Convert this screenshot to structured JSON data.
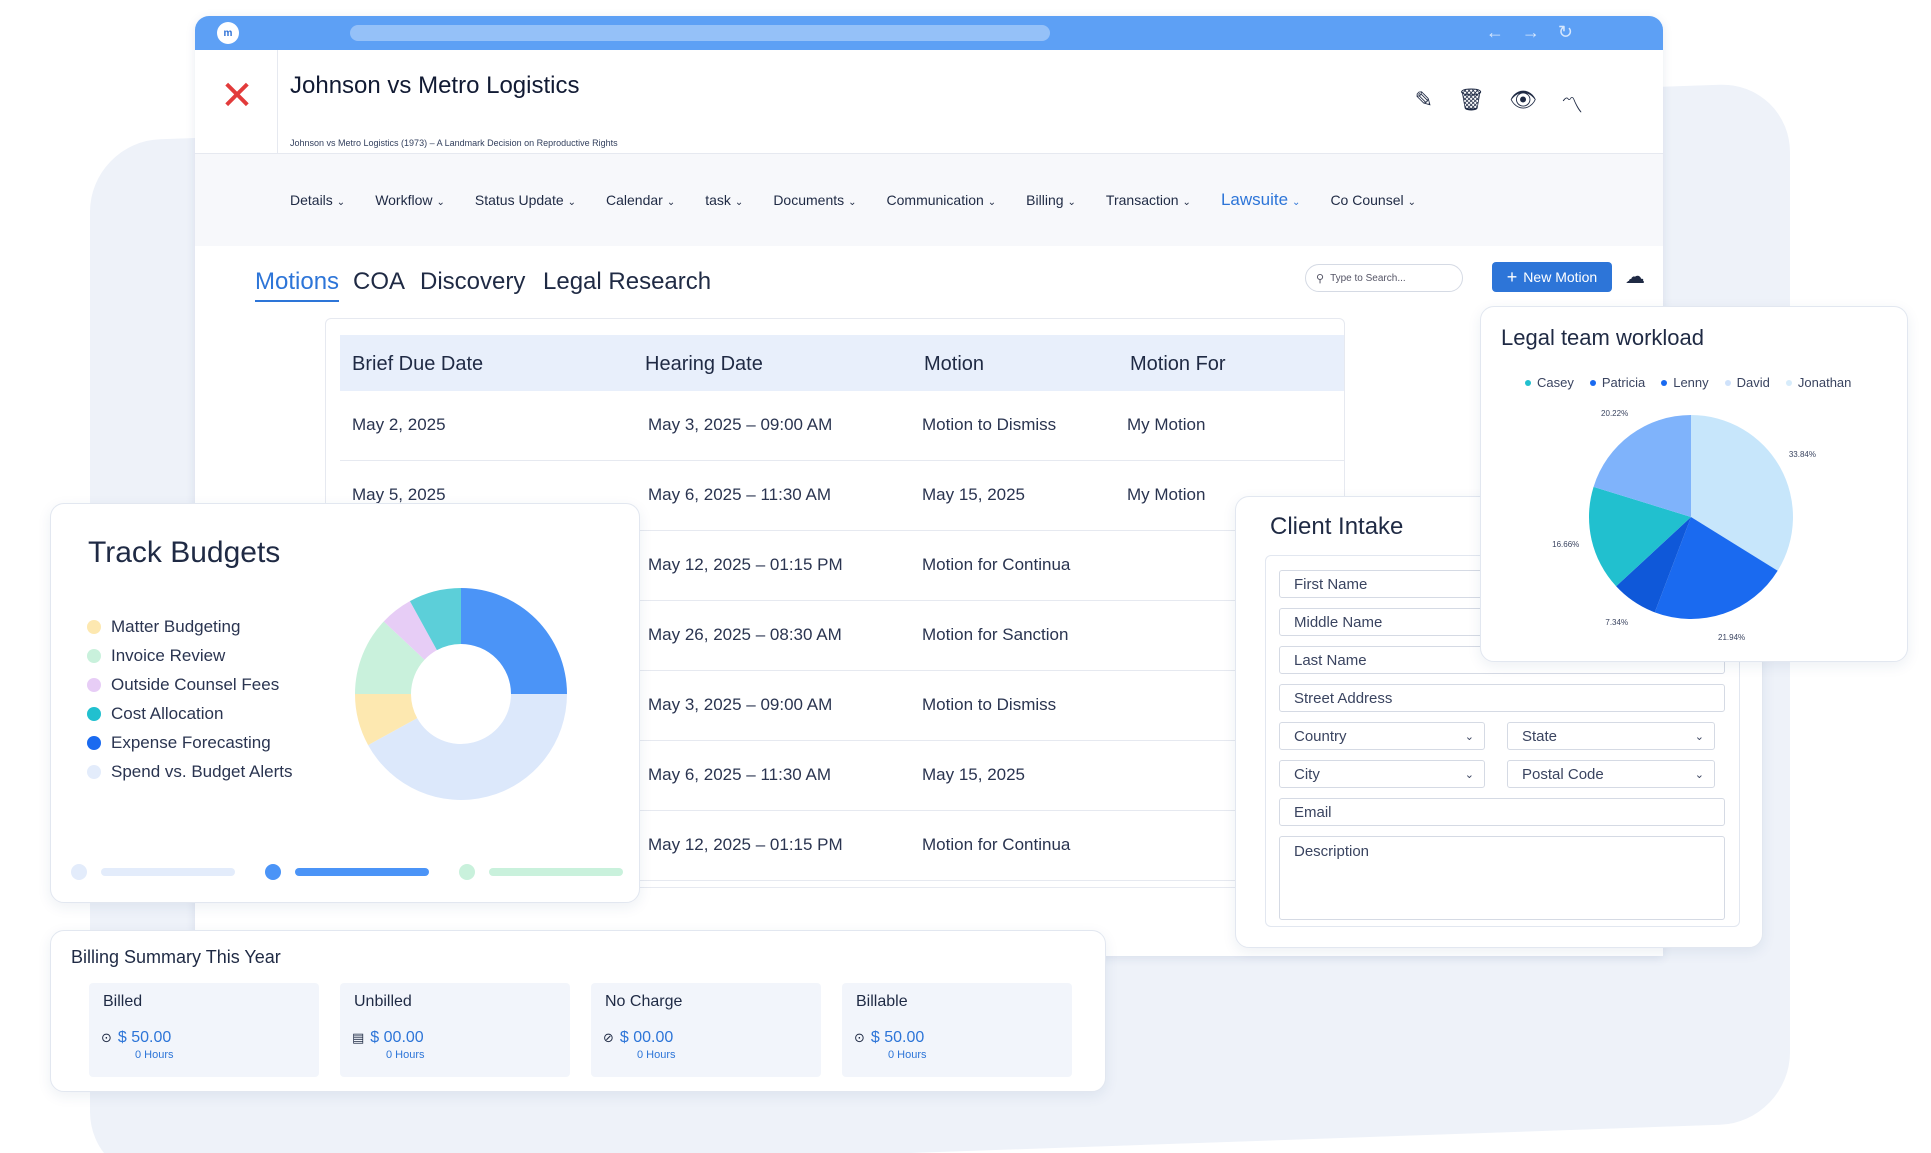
{
  "case": {
    "title": "Johnson vs Metro Logistics",
    "subtitle": "Johnson vs Metro Logistics (1973) – A Landmark Decision on Reproductive Rights"
  },
  "menu": [
    {
      "label": "Details"
    },
    {
      "label": "Workflow"
    },
    {
      "label": "Status Update"
    },
    {
      "label": "Calendar"
    },
    {
      "label": "task"
    },
    {
      "label": "Documents"
    },
    {
      "label": "Communication"
    },
    {
      "label": "Billing"
    },
    {
      "label": "Transaction"
    },
    {
      "label": "Lawsuite"
    },
    {
      "label": "Co Counsel"
    }
  ],
  "active_menu": "Lawsuite",
  "tabs": [
    {
      "label": "Motions"
    },
    {
      "label": "COA"
    },
    {
      "label": "Discovery"
    },
    {
      "label": "Legal Research"
    }
  ],
  "search": {
    "placeholder": "Type to Search..."
  },
  "new_motion_label": "New Motion",
  "table": {
    "headers": [
      "Brief Due Date",
      "Hearing Date",
      "Motion",
      "Motion For"
    ],
    "rows": [
      [
        "May 2, 2025",
        "May 3, 2025 – 09:00 AM",
        "Motion to Dismiss",
        "My Motion"
      ],
      [
        "May 5, 2025",
        "May 6, 2025 – 11:30 AM",
        "May 15, 2025",
        "My Motion"
      ],
      [
        "",
        "May 12, 2025 – 01:15 PM",
        "Motion for Continua",
        ""
      ],
      [
        "",
        "May 26, 2025 – 08:30 AM",
        "Motion for Sanction",
        ""
      ],
      [
        "",
        "May 3, 2025 – 09:00 AM",
        "Motion to Dismiss",
        ""
      ],
      [
        "",
        "May 6, 2025 – 11:30 AM",
        "May 15, 2025",
        ""
      ],
      [
        "",
        "May 12, 2025 – 01:15 PM",
        "Motion for Continua",
        ""
      ]
    ]
  },
  "budgets": {
    "title": "Track Budgets",
    "items": [
      {
        "label": "Matter Budgeting",
        "color": "#fde8b0"
      },
      {
        "label": "Invoice Review",
        "color": "#c9f1dc"
      },
      {
        "label": "Outside Counsel Fees",
        "color": "#e7cdf6"
      },
      {
        "label": "Cost Allocation",
        "color": "#21c0cf"
      },
      {
        "label": "Expense Forecasting",
        "color": "#1a6af0"
      },
      {
        "label": "Spend vs. Budget Alerts",
        "color": "#e3ecfb"
      }
    ],
    "donut": [
      {
        "color": "#4b94f7",
        "value": 25
      },
      {
        "color": "#dce8fb",
        "value": 42
      },
      {
        "color": "#fde8b0",
        "value": 8
      },
      {
        "color": "#c9f1dc",
        "value": 12
      },
      {
        "color": "#e7cdf6",
        "value": 5
      },
      {
        "color": "#5ccfd9",
        "value": 8
      }
    ]
  },
  "billing": {
    "title": "Billing Summary This Year",
    "boxes": [
      {
        "label": "Billed",
        "amount": "$ 50.00",
        "hours": "0 Hours",
        "icon": "dollar-circle-icon"
      },
      {
        "label": "Unbilled",
        "amount": "$ 00.00",
        "hours": "0 Hours",
        "icon": "receipt-icon"
      },
      {
        "label": "No Charge",
        "amount": "$ 00.00",
        "hours": "0 Hours",
        "icon": "no-charge-icon"
      },
      {
        "label": "Billable",
        "amount": "$ 50.00",
        "hours": "0 Hours",
        "icon": "dollar-circle-icon"
      }
    ]
  },
  "intake": {
    "title": "Client Intake",
    "fields": {
      "first_name": "First Name",
      "middle_name": "Middle Name",
      "last_name": "Last Name",
      "street": "Street Address",
      "country": "Country",
      "state": "State",
      "city": "City",
      "postal": "Postal Code",
      "email": "Email",
      "description": "Description"
    }
  },
  "workload": {
    "title": "Legal team workload",
    "legend": [
      {
        "name": "Casey",
        "color": "#21c0cf"
      },
      {
        "name": "Patricia",
        "color": "#1a6af0"
      },
      {
        "name": "Lenny",
        "color": "#1a6af0"
      },
      {
        "name": "David",
        "color": "#cfe2fb"
      },
      {
        "name": "Jonathan",
        "color": "#d7ecfb"
      }
    ],
    "slices": [
      {
        "value": 33.84,
        "label": "33.84%",
        "color": "#c7e6fb"
      },
      {
        "value": 21.94,
        "label": "21.94%",
        "color": "#1a6af0"
      },
      {
        "value": 7.34,
        "label": "7.34%",
        "color": "#0f58d9"
      },
      {
        "value": 16.66,
        "label": "16.66%",
        "color": "#21c0cf"
      },
      {
        "value": 20.22,
        "label": "20.22%",
        "color": "#7fb3fb"
      }
    ]
  },
  "chart_data": {
    "type": "pie",
    "title": "Legal team workload",
    "legend": [
      "Casey",
      "Patricia",
      "Lenny",
      "David",
      "Jonathan"
    ],
    "values": [
      33.84,
      21.94,
      7.34,
      16.66,
      20.22
    ],
    "labels": [
      "33.84%",
      "21.94%",
      "7.34%",
      "16.66%",
      "20.22%"
    ]
  }
}
